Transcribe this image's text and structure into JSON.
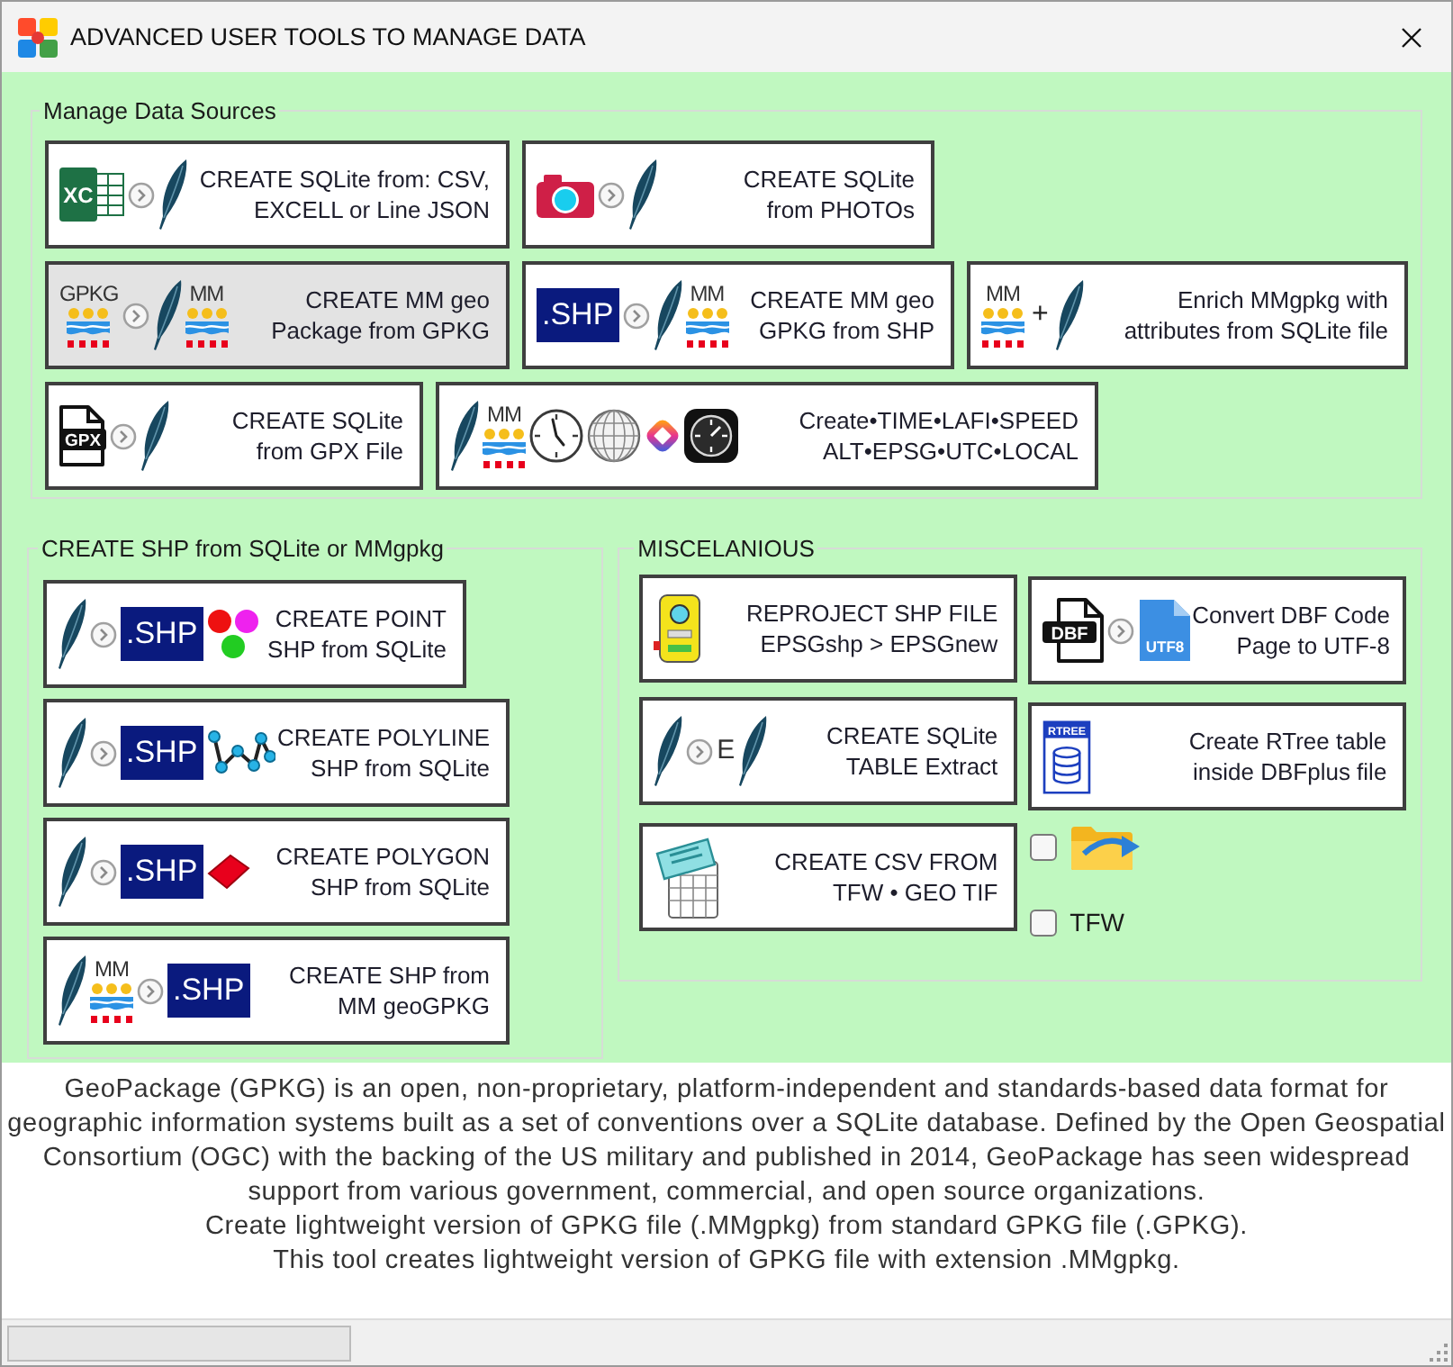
{
  "window": {
    "title": "ADVANCED USER TOOLS TO MANAGE DATA"
  },
  "manage_data_sources": {
    "title": "Manage Data Sources",
    "buttons": [
      {
        "label": [
          "CREATE SQLite from: CSV,",
          "EXCELL or Line JSON"
        ],
        "icon_texts": [
          "XC"
        ],
        "highlighted": false
      },
      {
        "label": [
          "CREATE SQLite",
          "from PHOTOs"
        ],
        "highlighted": false
      },
      {
        "label": [
          "CREATE MM geo",
          "Package from GPKG"
        ],
        "icon_texts": [
          "GPKG",
          "MM"
        ],
        "highlighted": true
      },
      {
        "label": [
          "CREATE MM geo",
          "GPKG from SHP"
        ],
        "icon_texts": [
          ".SHP",
          "MM"
        ],
        "highlighted": false
      },
      {
        "label": [
          "Enrich MMgpkg with",
          "attributes from SQLite file"
        ],
        "icon_texts": [
          "MM",
          "+"
        ],
        "highlighted": false
      },
      {
        "label": [
          "CREATE SQLite",
          "from GPX File"
        ],
        "icon_texts": [
          "GPX"
        ],
        "highlighted": false
      },
      {
        "label": [
          "Create•TIME•LAFI•SPEED",
          "ALT•EPSG•UTC•LOCAL"
        ],
        "icon_texts": [
          "MM"
        ],
        "highlighted": false
      }
    ]
  },
  "create_shp": {
    "title": "CREATE SHP from SQLite or MMgpkg",
    "buttons": [
      {
        "label": [
          "CREATE POINT",
          "SHP from SQLite"
        ],
        "icon_texts": [
          ".SHP"
        ]
      },
      {
        "label": [
          "CREATE POLYLINE",
          "SHP from SQLite"
        ],
        "icon_texts": [
          ".SHP"
        ]
      },
      {
        "label": [
          "CREATE POLYGON",
          "SHP from SQLite"
        ],
        "icon_texts": [
          ".SHP"
        ]
      },
      {
        "label": [
          "CREATE SHP from",
          "MM geoGPKG"
        ],
        "icon_texts": [
          "MM",
          ".SHP"
        ]
      }
    ]
  },
  "miscellaneous": {
    "title": "MISCELANIOUS",
    "buttons": [
      {
        "label": [
          "REPROJECT SHP FILE",
          "EPSGshp > EPSGnew"
        ]
      },
      {
        "label": [
          "Convert DBF Code",
          "Page to UTF-8"
        ],
        "icon_texts": [
          "DBF",
          "UTF8"
        ]
      },
      {
        "label": [
          "CREATE SQLite",
          "TABLE Extract"
        ],
        "icon_texts": [
          "E"
        ]
      },
      {
        "label": [
          "Create RTree table",
          "inside DBFplus file"
        ],
        "icon_texts": [
          "RTREE"
        ]
      },
      {
        "label": [
          "CREATE CSV FROM",
          "TFW • GEO TIF"
        ]
      }
    ],
    "checkboxes": [
      {
        "checked": false
      },
      {
        "label": "TFW",
        "checked": false
      }
    ]
  },
  "description": [
    "GeoPackage (GPKG) is an open, non-proprietary, platform-independent and standards-based data format for geographic information systems built as a set of conventions over a SQLite database. Defined by the Open Geospatial Consortium (OGC) with the backing of the US military and published in 2014, GeoPackage has seen widespread support from various government, commercial, and open source organizations.",
    "Create lightweight version of GPKG file (.MMgpkg) from standard GPKG file (.GPKG).",
    "This tool creates lightweight version of GPKG file with extension .MMgpkg."
  ],
  "status_bar": {
    "progress": {
      "level": 0
    }
  }
}
